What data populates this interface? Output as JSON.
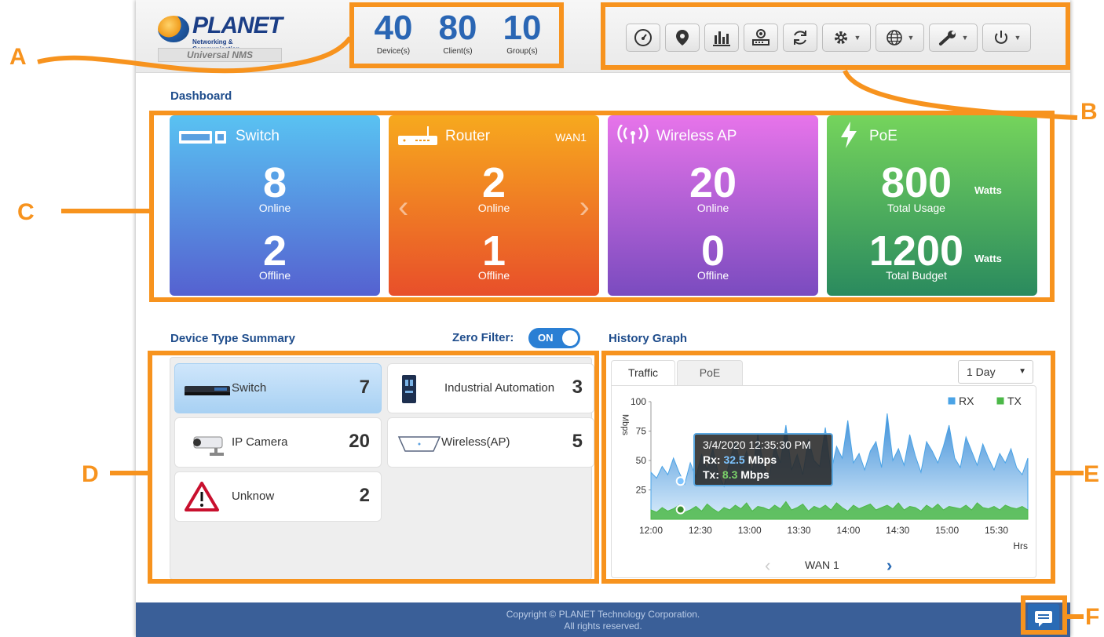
{
  "header": {
    "logo_brand": "PLANET",
    "logo_tagline": "Networking & Communication",
    "logo_product": "Universal NMS",
    "stats": [
      {
        "value": "40",
        "label": "Device(s)"
      },
      {
        "value": "80",
        "label": "Client(s)"
      },
      {
        "value": "10",
        "label": "Group(s)"
      }
    ],
    "toolbar_icons": [
      "dashboard-icon",
      "map-pin-icon",
      "bar-chart-icon",
      "network-device-icon",
      "refresh-icon",
      "gear-icon",
      "globe-icon",
      "wrench-icon",
      "power-icon"
    ]
  },
  "dashboard": {
    "title": "Dashboard",
    "cards": {
      "switch": {
        "title": "Switch",
        "online": "8",
        "online_label": "Online",
        "offline": "2",
        "offline_label": "Offline"
      },
      "router": {
        "title": "Router",
        "badge": "WAN1",
        "online": "2",
        "online_label": "Online",
        "offline": "1",
        "offline_label": "Offline"
      },
      "ap": {
        "title": "Wireless AP",
        "online": "20",
        "online_label": "Online",
        "offline": "0",
        "offline_label": "Offline"
      },
      "poe": {
        "title": "PoE",
        "usage": "800",
        "usage_unit": "Watts",
        "usage_label": "Total Usage",
        "budget": "1200",
        "budget_unit": "Watts",
        "budget_label": "Total Budget"
      }
    }
  },
  "device_summary": {
    "title": "Device Type Summary",
    "zero_filter_label": "Zero Filter:",
    "zero_filter_state": "ON",
    "items": [
      {
        "name": "Switch",
        "count": "7"
      },
      {
        "name": "Industrial Automation",
        "count": "3"
      },
      {
        "name": "IP Camera",
        "count": "20"
      },
      {
        "name": "Wireless(AP)",
        "count": "5"
      },
      {
        "name": "Unknow",
        "count": "2"
      }
    ]
  },
  "history": {
    "title": "History Graph",
    "tabs": [
      "Traffic",
      "PoE"
    ],
    "range": "1 Day",
    "nav_label": "WAN 1",
    "tooltip": {
      "time": "3/4/2020 12:35:30 PM",
      "rx_label": "Rx:",
      "rx_value": "32.5",
      "tx_label": "Tx:",
      "tx_value": "8.3",
      "unit": "Mbps"
    }
  },
  "chart_data": {
    "type": "area",
    "ylabel": "Mbps",
    "xlabel": "Hrs",
    "ylim": [
      0,
      100
    ],
    "yticks": [
      "100",
      "75",
      "50",
      "25"
    ],
    "xticks": [
      "12:00",
      "12:30",
      "13:00",
      "13:30",
      "14:00",
      "14:30",
      "15:00",
      "15:30"
    ],
    "series": [
      {
        "name": "RX",
        "color": "#4aa3e6",
        "values": [
          40,
          35,
          45,
          38,
          52,
          40,
          30,
          48,
          36,
          55,
          42,
          60,
          38,
          28,
          50,
          66,
          44,
          58,
          40,
          72,
          46,
          36,
          62,
          48,
          80,
          42,
          55,
          38,
          68,
          50,
          45,
          78,
          40,
          62,
          52,
          84,
          48,
          56,
          42,
          58,
          66,
          44,
          90,
          50,
          60,
          46,
          72,
          54,
          40,
          66,
          58,
          48,
          62,
          80,
          52,
          44,
          70,
          58,
          46,
          64,
          52,
          42,
          56,
          48,
          60,
          44,
          38,
          52
        ]
      },
      {
        "name": "TX",
        "color": "#4cb848",
        "values": [
          8,
          6,
          10,
          7,
          9,
          12,
          6,
          8,
          11,
          7,
          13,
          9,
          6,
          10,
          8,
          12,
          9,
          14,
          7,
          11,
          10,
          8,
          12,
          9,
          15,
          8,
          10,
          13,
          7,
          11,
          9,
          12,
          8,
          14,
          10,
          7,
          12,
          9,
          11,
          13,
          8,
          10,
          12,
          9,
          14,
          8,
          11,
          10,
          7,
          12,
          9,
          13,
          8,
          11,
          10,
          9,
          12,
          8,
          14,
          10,
          9,
          11,
          8,
          12,
          10,
          9,
          11,
          8
        ]
      }
    ]
  },
  "footer": {
    "copyright": "Copyright © PLANET Technology Corporation.",
    "rights": "All rights reserved."
  },
  "callouts": [
    "A",
    "B",
    "C",
    "D",
    "E",
    "F"
  ],
  "colors": {
    "accent": "#f7931e",
    "brand_blue": "#1b3e86",
    "footer": "#3a5f98"
  }
}
